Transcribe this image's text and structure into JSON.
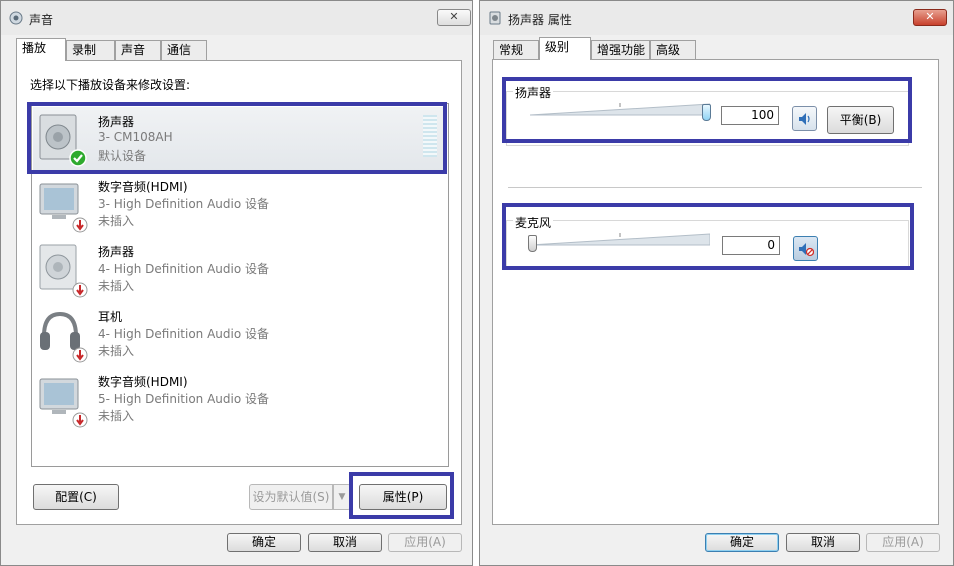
{
  "left_window": {
    "title": "声音",
    "close_glyph": "✕",
    "tabs": [
      {
        "label": "播放"
      },
      {
        "label": "录制"
      },
      {
        "label": "声音"
      },
      {
        "label": "通信"
      }
    ],
    "instruction": "选择以下播放设备来修改设置:",
    "devices": [
      {
        "name": "扬声器",
        "desc": "3- CM108AH",
        "status": "默认设备",
        "icon": "speaker-icon",
        "badge": "check-icon"
      },
      {
        "name": "数字音频(HDMI)",
        "desc": "3- High Definition Audio 设备",
        "status": "未插入",
        "icon": "monitor-icon",
        "badge": "unplugged-icon"
      },
      {
        "name": "扬声器",
        "desc": "4- High Definition Audio 设备",
        "status": "未插入",
        "icon": "speaker-icon",
        "badge": "unplugged-icon"
      },
      {
        "name": "耳机",
        "desc": "4- High Definition Audio 设备",
        "status": "未插入",
        "icon": "headphones-icon",
        "badge": "unplugged-icon"
      },
      {
        "name": "数字音频(HDMI)",
        "desc": "5- High Definition Audio 设备",
        "status": "未插入",
        "icon": "monitor-icon",
        "badge": "unplugged-icon"
      }
    ],
    "buttons": {
      "configure": "配置(C)",
      "set_default": "设为默认值(S)",
      "set_default_arrow": "▼",
      "properties": "属性(P)",
      "ok": "确定",
      "cancel": "取消",
      "apply": "应用(A)"
    }
  },
  "right_window": {
    "title": "扬声器 属性",
    "close_glyph": "✕",
    "tabs": [
      {
        "label": "常规"
      },
      {
        "label": "级别"
      },
      {
        "label": "增强功能"
      },
      {
        "label": "高级"
      }
    ],
    "speaker_group": {
      "label": "扬声器",
      "value": "100",
      "level": 1.0,
      "balance_button": "平衡(B)",
      "mute_icon": "speaker-volume-icon"
    },
    "mic_group": {
      "label": "麦克风",
      "value": "0",
      "level": 0.0,
      "mute_icon": "speaker-muted-icon"
    },
    "buttons": {
      "ok": "确定",
      "cancel": "取消",
      "apply": "应用(A)"
    }
  },
  "colors": {
    "highlight": "#3b3ba8",
    "accent": "#3c7fb1",
    "check": "#2eaa2e",
    "unplugged": "#c8282a"
  }
}
